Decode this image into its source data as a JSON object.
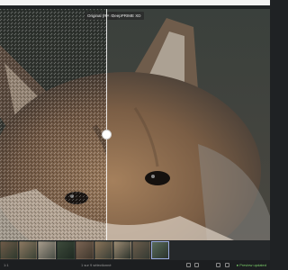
{
  "viewer": {
    "left_label": "Original (RAW)",
    "right_label": "DeepPRIME XD"
  },
  "filmstrip": {
    "thumbnails": [
      {
        "color_a": "#6f5a48",
        "color_b": "#2f3a2e"
      },
      {
        "color_a": "#8b7760",
        "color_b": "#3c4336"
      },
      {
        "color_a": "#a69a8a",
        "color_b": "#4a4f47"
      },
      {
        "color_a": "#3d4a3b",
        "color_b": "#1f2a22"
      },
      {
        "color_a": "#7a6352",
        "color_b": "#40382e"
      },
      {
        "color_a": "#8a7358",
        "color_b": "#3b3f37"
      },
      {
        "color_a": "#9b8a72",
        "color_b": "#2e342d"
      },
      {
        "color_a": "#6b5c4b",
        "color_b": "#353a33"
      },
      {
        "color_a": "#596b5a",
        "color_b": "#2a332c"
      }
    ]
  },
  "statusbar": {
    "zoom": "1:1",
    "selection": "1 sur 9 sélectionné",
    "preview": "● Preview updated"
  },
  "colors": {
    "accent_green": "#7ccf6a",
    "background": "#1f2224"
  }
}
